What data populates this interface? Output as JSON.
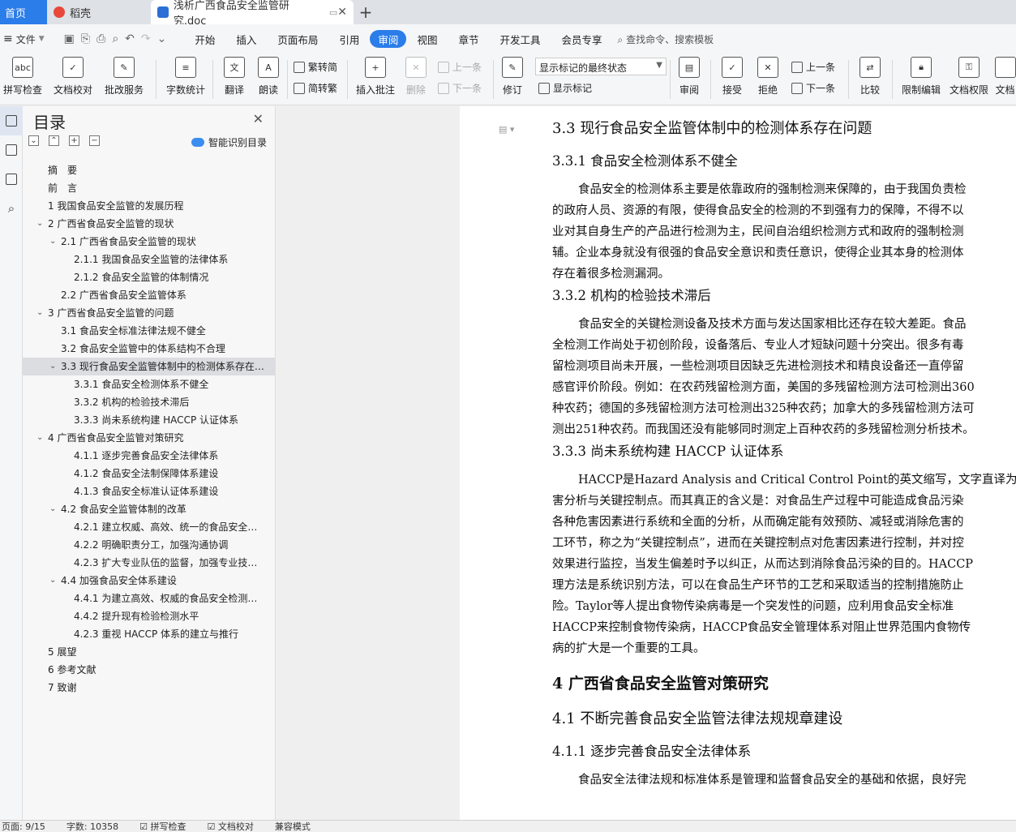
{
  "tabs": {
    "home": "首页",
    "daoke": "稻壳",
    "doc": "浅析广西食品安全监管研究.doc"
  },
  "menu": {
    "file": "文件",
    "items": [
      "开始",
      "插入",
      "页面布局",
      "引用",
      "审阅",
      "视图",
      "章节",
      "开发工具",
      "会员专享"
    ],
    "active": "审阅",
    "search": "查找命令、搜索模板"
  },
  "ribbon": {
    "spell": "拼写检查",
    "proof": "文档校对",
    "annotate_service": "批改服务",
    "word_count": "字数统计",
    "translate": "翻译",
    "read_aloud": "朗读",
    "trad": "繁转简",
    "simp": "简转繁",
    "insert_comment": "插入批注",
    "delete": "删除",
    "prev": "上一条",
    "next": "下一条",
    "track": "修订",
    "display_state": "显示标记的最终状态",
    "show_marks": "显示标记",
    "review": "审阅",
    "accept": "接受",
    "reject": "拒绝",
    "prev2": "上一条",
    "next2": "下一条",
    "compare": "比较",
    "restrict": "限制编辑",
    "doc_perm": "文档权限",
    "doc_more": "文档"
  },
  "toc": {
    "title": "目录",
    "smart": "智能识别目录",
    "items": [
      {
        "text": "摘　要",
        "level": 0,
        "arrow": ""
      },
      {
        "text": "前　言",
        "level": 0,
        "arrow": ""
      },
      {
        "text": "1 我国食品安全监管的发展历程",
        "level": 0,
        "arrow": ""
      },
      {
        "text": "2 广西省食品安全监管的现状",
        "level": 0,
        "arrow": "v"
      },
      {
        "text": "2.1 广西省食品安全监管的现状",
        "level": 1,
        "arrow": "v"
      },
      {
        "text": "2.1.1 我国食品安全监管的法律体系",
        "level": 2,
        "arrow": ""
      },
      {
        "text": "2.1.2 食品安全监管的体制情况",
        "level": 2,
        "arrow": ""
      },
      {
        "text": "2.2 广西省食品安全监管体系",
        "level": 1,
        "arrow": ""
      },
      {
        "text": "3 广西省食品安全监管的问题",
        "level": 0,
        "arrow": "v"
      },
      {
        "text": "3.1 食品安全标准法律法规不健全",
        "level": 1,
        "arrow": ""
      },
      {
        "text": "3.2 食品安全监管中的体系结构不合理",
        "level": 1,
        "arrow": ""
      },
      {
        "text": "3.3 现行食品安全监管体制中的检测体系存在问题",
        "level": 1,
        "arrow": "v",
        "selected": true
      },
      {
        "text": "3.3.1 食品安全检测体系不健全",
        "level": 2,
        "arrow": ""
      },
      {
        "text": "3.3.2 机构的检验技术滞后",
        "level": 2,
        "arrow": ""
      },
      {
        "text": "3.3.3 尚未系统构建 HACCP 认证体系",
        "level": 2,
        "arrow": ""
      },
      {
        "text": "4 广西省食品安全监管对策研究",
        "level": 0,
        "arrow": "v"
      },
      {
        "text": "4.1.1 逐步完善食品安全法律体系",
        "level": 2,
        "arrow": ""
      },
      {
        "text": "4.1.2 食品安全法制保障体系建设",
        "level": 2,
        "arrow": ""
      },
      {
        "text": "4.1.3 食品安全标准认证体系建设",
        "level": 2,
        "arrow": ""
      },
      {
        "text": "4.2 食品安全监管体制的改革",
        "level": 1,
        "arrow": "v"
      },
      {
        "text": "4.2.1 建立权威、高效、统一的食品安全监管机构",
        "level": 2,
        "arrow": ""
      },
      {
        "text": "4.2.2 明确职责分工，加强沟通协调",
        "level": 2,
        "arrow": ""
      },
      {
        "text": "4.2.3 扩大专业队伍的监督，加强专业技术培训",
        "level": 2,
        "arrow": ""
      },
      {
        "text": "4.4 加强食品安全体系建设",
        "level": 1,
        "arrow": "v"
      },
      {
        "text": "4.4.1 为建立高效、权威的食品安全检测体系",
        "level": 2,
        "arrow": ""
      },
      {
        "text": "4.4.2 提升现有检验检测水平",
        "level": 2,
        "arrow": ""
      },
      {
        "text": "4.2.3 重视 HACCP 体系的建立与推行",
        "level": 2,
        "arrow": ""
      },
      {
        "text": "5 展望",
        "level": 0,
        "arrow": ""
      },
      {
        "text": "6 参考文献",
        "level": 0,
        "arrow": ""
      },
      {
        "text": "7 致谢",
        "level": 0,
        "arrow": ""
      }
    ]
  },
  "doc": {
    "blocks": [
      {
        "type": "h2",
        "text": "3.3 现行食品安全监管体制中的检测体系存在问题"
      },
      {
        "type": "h3",
        "text": "3.3.1 食品安全检测体系不健全"
      },
      {
        "type": "para",
        "lines": [
          "食品安全的检测体系主要是依靠政府的强制检测来保障的，由于我国负责检",
          "的政府人员、资源的有限，使得食品安全的检测的不到强有力的保障，不得不以",
          "业对其自身生产的产品进行检测为主，民间自治组织检测方式和政府的强制检测",
          "辅。企业本身就没有很强的食品安全意识和责任意识，使得企业其本身的检测体",
          "存在着很多检测漏洞。"
        ]
      },
      {
        "type": "h3",
        "text": "3.3.2 机构的检验技术滞后"
      },
      {
        "type": "para",
        "lines": [
          "食品安全的关键检测设备及技术方面与发达国家相比还存在较大差距。食品",
          "全检测工作尚处于初创阶段，设备落后、专业人才短缺问题十分突出。很多有毒",
          "留检测项目尚未开展，一些检测项目因缺乏先进检测技术和精良设备还一直停留",
          "感官评价阶段。例如：在农药残留检测方面，美国的多残留检测方法可检测出360",
          "种农药；德国的多残留检测方法可检测出325种农药；加拿大的多残留检测方法可",
          "测出251种农药。而我国还没有能够同时测定上百种农药的多残留检测分析技术。"
        ]
      },
      {
        "type": "h3",
        "text": "3.3.3 尚未系统构建 HACCP 认证体系"
      },
      {
        "type": "para",
        "lines": [
          "HACCP是Hazard Analysis and Critical Control Point的英文缩写，文字直译为：",
          "害分析与关键控制点。而其真正的含义是：对食品生产过程中可能造成食品污染",
          "各种危害因素进行系统和全面的分析，从而确定能有效预防、减轻或消除危害的",
          "工环节，称之为“关键控制点”，进而在关键控制点对危害因素进行控制，并对控",
          "效果进行监控，当发生偏差时予以纠正，从而达到消除食品污染的目的。HACCP",
          "理方法是系统识别方法，可以在食品生产环节的工艺和采取适当的控制措施防止",
          "险。Taylor等人提出食物传染病毒是一个突发性的问题，应利用食品安全标准",
          "HACCP来控制食物传染病，HACCP食品安全管理体系对阻止世界范围内食物传",
          "病的扩大是一个重要的工具。"
        ]
      },
      {
        "type": "h1",
        "text": "4 广西省食品安全监管对策研究"
      },
      {
        "type": "h2",
        "text": "4.1 不断完善食品安全监管法律法规规章建设"
      },
      {
        "type": "h3",
        "text": "4.1.1 逐步完善食品安全法律体系"
      },
      {
        "type": "para",
        "lines": [
          "食品安全法律法规和标准体系是管理和监督食品安全的基础和依据，良好完"
        ]
      }
    ]
  },
  "status": {
    "page": "页面: 9/15",
    "words": "字数: 10358",
    "spell": "拼写检查",
    "proof": "文档校对",
    "compat": "兼容模式"
  }
}
